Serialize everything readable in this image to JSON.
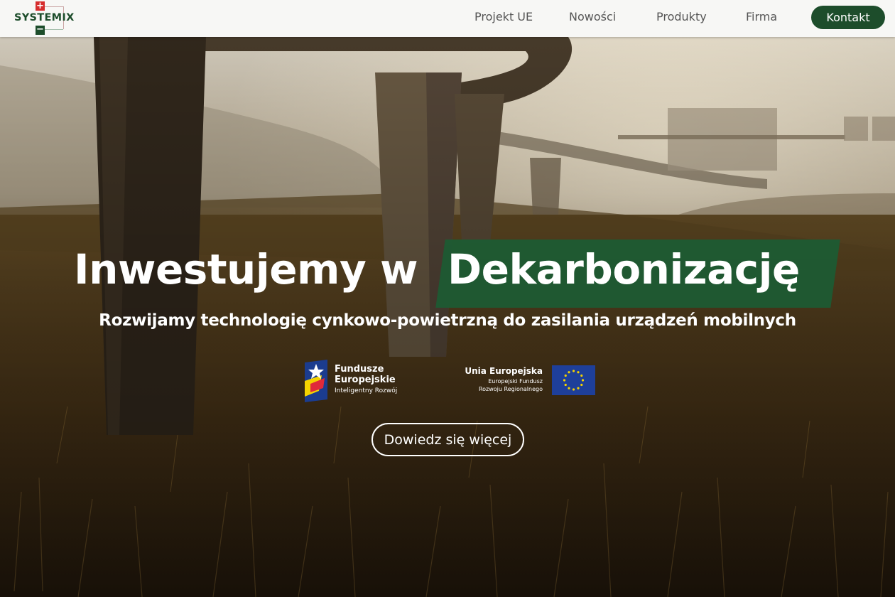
{
  "brand": {
    "name": "SYSTEMIX",
    "plus_symbol": "+",
    "minus_symbol": "−",
    "brand_green": "#1d4d2b",
    "brand_red": "#d62d2d"
  },
  "nav": {
    "links": [
      {
        "label": "Projekt UE"
      },
      {
        "label": "Nowości"
      },
      {
        "label": "Produkty"
      },
      {
        "label": "Firma"
      }
    ],
    "contact_label": "Kontakt"
  },
  "hero": {
    "headline_plain": "Inwestujemy w",
    "headline_highlight": "Dekarbonizację",
    "highlight_color": "#1e5a33",
    "subheadline": "Rozwijamy technologię cynkowo-powietrzną do zasilania urządzeń mobilnych",
    "cta_label": "Dowiedz się więcej"
  },
  "eu_logos": {
    "funds": {
      "line1": "Fundusze",
      "line2": "Europejskie",
      "line3": "Inteligentny Rozwój",
      "icon": "european-funds-star-icon"
    },
    "union": {
      "line1": "Unia Europejska",
      "line2": "Europejski Fundusz",
      "line3": "Rozwoju Regionalnego",
      "icon": "eu-flag-icon",
      "flag_color": "#1e3f9a",
      "star_color": "#f5d300"
    }
  }
}
